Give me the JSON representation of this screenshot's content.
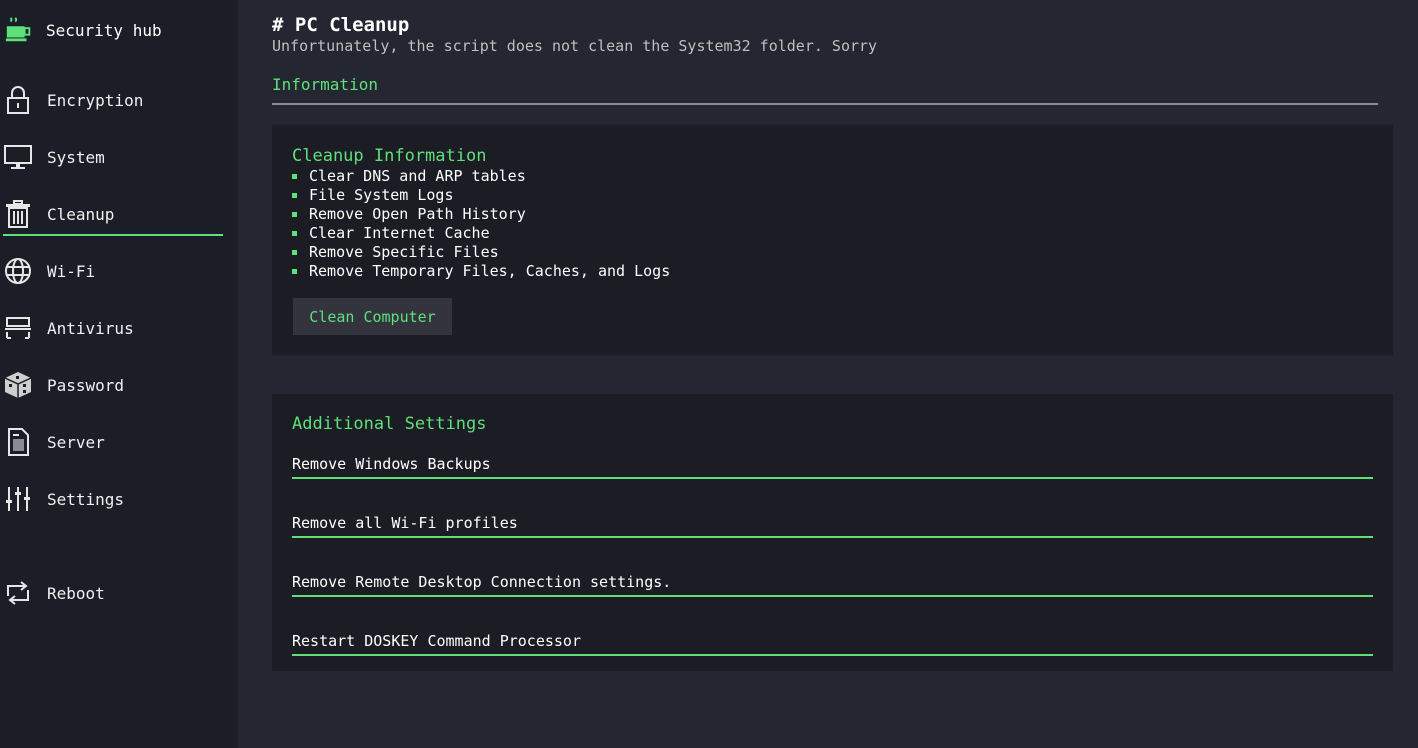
{
  "sidebar": {
    "brand": {
      "label": "Security hub",
      "icon": "coffee-cup-icon"
    },
    "items": [
      {
        "label": "Encryption",
        "icon": "padlock-icon",
        "active": false
      },
      {
        "label": "System",
        "icon": "monitor-icon",
        "active": false
      },
      {
        "label": "Cleanup",
        "icon": "trash-can-icon",
        "active": true
      },
      {
        "label": "Wi-Fi",
        "icon": "globe-icon",
        "active": false
      },
      {
        "label": "Antivirus",
        "icon": "scanner-icon",
        "active": false
      },
      {
        "label": "Password",
        "icon": "dice-icon",
        "active": false
      },
      {
        "label": "Server",
        "icon": "document-icon",
        "active": false
      },
      {
        "label": "Settings",
        "icon": "sliders-icon",
        "active": false
      },
      {
        "label": "Reboot",
        "icon": "reboot-arrows-icon",
        "active": false
      }
    ]
  },
  "main": {
    "title": "# PC Cleanup",
    "subtitle": "Unfortunately, the script does not clean the System32 folder. Sorry",
    "section_tab": "Information",
    "cleanup_card": {
      "title": "Cleanup Information",
      "items": [
        "Clear DNS and ARP tables",
        "File System Logs",
        "Remove Open Path History",
        "Clear Internet Cache",
        "Remove Specific Files",
        "Remove Temporary Files, Caches, and Logs"
      ],
      "button_label": "Clean Computer"
    },
    "additional_card": {
      "title": "Additional Settings",
      "settings": [
        "Remove Windows Backups",
        "Remove all Wi-Fi profiles",
        "Remove Remote Desktop Connection settings.",
        "Restart DOSKEY Command Processor"
      ]
    }
  },
  "colors": {
    "accent": "#5ee07a",
    "sidebar_bg": "#1c1e27",
    "main_bg": "#242631",
    "card_bg": "#1b1c24",
    "button_bg": "#33343e"
  }
}
